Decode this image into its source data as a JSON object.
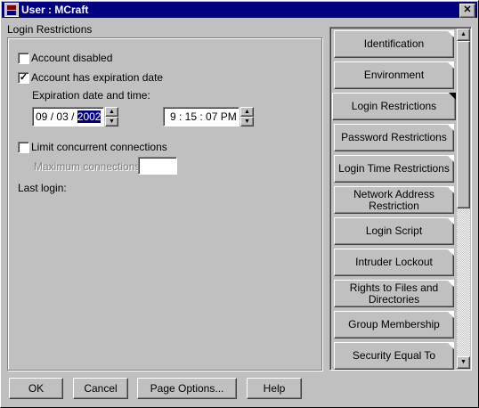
{
  "window": {
    "title": "User : MCraft"
  },
  "login": {
    "group_title": "Login Restrictions",
    "account_disabled": {
      "label": "Account disabled",
      "checked": false
    },
    "account_expires": {
      "label": "Account has expiration date",
      "checked": true
    },
    "expiration_label": "Expiration date and time:",
    "date_month": "09",
    "date_day": "03",
    "date_year": "2002",
    "date_sep": "/",
    "time_value": "9 : 15 : 07 PM",
    "limit_concurrent": {
      "label": "Limit concurrent connections",
      "checked": false
    },
    "max_connections_label": "Maximum connections:",
    "max_connections_value": "",
    "last_login_label": "Last login:"
  },
  "tabs": [
    "Identification",
    "Environment",
    "Login Restrictions",
    "Password Restrictions",
    "Login Time Restrictions",
    "Network Address Restriction",
    "Login Script",
    "Intruder Lockout",
    "Rights to Files and Directories",
    "Group Membership",
    "Security Equal To"
  ],
  "active_tab": "Login Restrictions",
  "buttons": {
    "ok": "OK",
    "cancel": "Cancel",
    "page_options": "Page Options...",
    "help": "Help"
  }
}
